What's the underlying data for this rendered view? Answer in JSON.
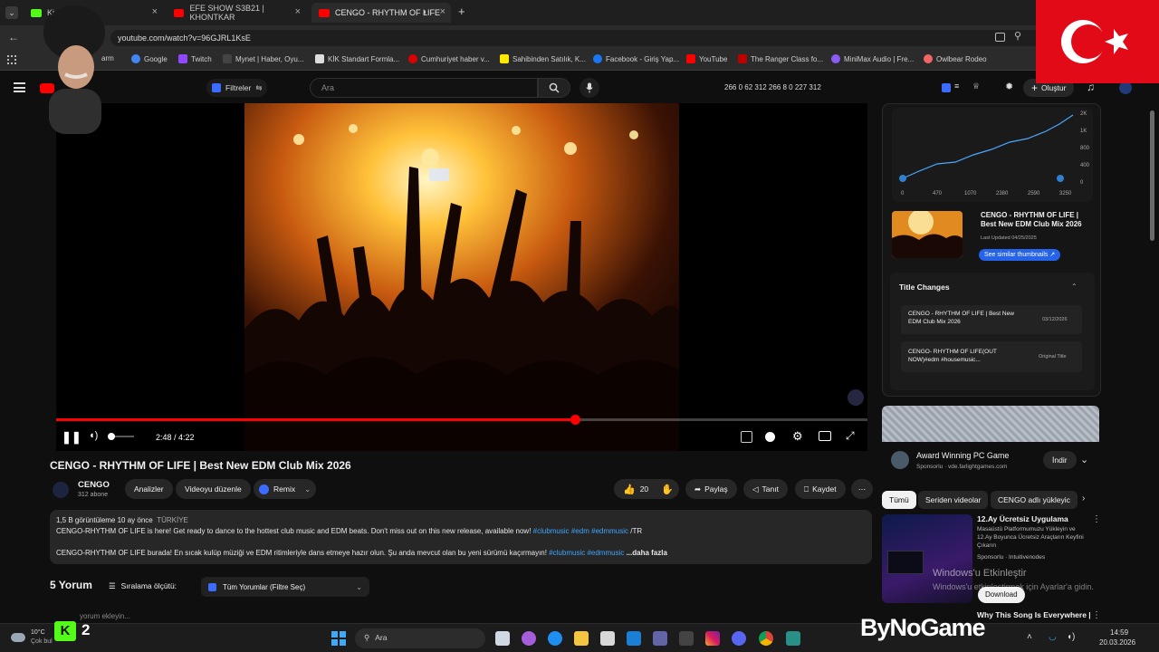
{
  "browser": {
    "tabs": [
      {
        "title": "Kick",
        "favicon_color": "#53fc18"
      },
      {
        "title": "EFE SHOW S3B21 | KHONTKAR",
        "favicon_color": "#ff0000"
      },
      {
        "title": "CENGO - RHYTHM OF LIFE",
        "favicon_color": "#ff0000",
        "active": true
      }
    ],
    "new_tab": "+",
    "url": "youtube.com/watch?v=96GJRL1KsE",
    "bookmarks": [
      {
        "label": "arm",
        "color": "#e44"
      },
      {
        "label": "Google",
        "color": "#4285f4"
      },
      {
        "label": "Twitch",
        "color": "#9146ff"
      },
      {
        "label": "Mynet | Haber, Oyu...",
        "color": "#333"
      },
      {
        "label": "KİK Standart Formla...",
        "color": "#ddd"
      },
      {
        "label": "Cumhuriyet haber v...",
        "color": "#d00"
      },
      {
        "label": "Sahibinden Satılık, K...",
        "color": "#ffe800"
      },
      {
        "label": "Facebook - Giriş Yap...",
        "color": "#1877f2"
      },
      {
        "label": "YouTube",
        "color": "#ff0000"
      },
      {
        "label": "The Ranger Class fo...",
        "color": "#b00"
      },
      {
        "label": "MiniMax Audio | Fre...",
        "color": "#8a5cf6"
      },
      {
        "label": "Owlbear Rodeo",
        "color": "#e66"
      }
    ]
  },
  "header": {
    "filters_label": "Filtreler",
    "search_placeholder": "Ara",
    "stats": "266  0  62  312  266  8  0  227  312",
    "create_label": "Oluştur"
  },
  "player": {
    "time": "2:48 / 4:22",
    "progress": 0.64,
    "volume": 0.1
  },
  "video": {
    "title": "CENGO - RHYTHM OF LIFE | Best New EDM Club Mix 2026",
    "channel": "CENGO",
    "subscribers": "312 abone",
    "btn_analytics": "Analizler",
    "btn_edit": "Videoyu düzenle",
    "btn_remix": "Remix",
    "likes": "20",
    "btn_share": "Paylaş",
    "btn_promote": "Tanıt",
    "btn_save": "Kaydet",
    "desc_meta": "1,5 B görüntüleme  10 ay önce",
    "desc_country": "TÜRKİYE",
    "desc_line1": "CENGO-RHYTHM OF LIFE is here! Get ready to dance to the hottest club music and EDM beats. Don't miss out on this new release, available now! ",
    "desc_tags1": "#clubmusic #edm #edmmusic",
    "desc_tail1": " /TR",
    "desc_line2": "CENGO-RHYTHM OF LIFE  burada! En sıcak kulüp müziği ve EDM ritimleriyle dans etmeye hazır olun. Şu anda mevcut olan bu yeni sürümü kaçırmayın! ",
    "desc_tags2": "#clubmusic #edmmusic",
    "desc_more": " ...daha fazla",
    "comments_count": "5 Yorum",
    "sort_label": "Sıralama ölçütü:",
    "comment_filter": "Tüm Yorumlar (Filtre Seç)",
    "add_comment": "yorum ekleyin..."
  },
  "side": {
    "chart_y_ticks": [
      "2K",
      "1K",
      "800",
      "400",
      "0"
    ],
    "chart_x_ticks": [
      "0",
      "470",
      "1070",
      "2380",
      "2590",
      "3250"
    ],
    "thumb_title": "CENGO - RHYTHM OF LIFE | Best New EDM Club Mix 2026",
    "last_updated": "Last Updated 04/25/2025",
    "similar_btn": "See similar thumbnails",
    "title_changes_header": "Title Changes",
    "change1_title": "CENGO - RHYTHM OF LIFE | Best New EDM Club Mix 2026",
    "change1_date": "03/12/2026",
    "change2_title": "CENGO- RHYTHM OF LIFE(OUT NOW)#edm #housemusic...",
    "change2_date": "Original Title"
  },
  "ad": {
    "title": "Award Winning PC Game",
    "sponsor": "Sponsorlu · vde.farlightgames.com",
    "install": "İndir"
  },
  "chips": [
    "Tümü",
    "Seriden videolar",
    "CENGO adlı yükleyic"
  ],
  "rec": {
    "title": "12.Ay Ücretsiz Uygulama",
    "desc": "Masaüstü Platformumuzu Yükleyin ve 12.Ay Boyunca Ücretsiz Araçların Keyfini Çıkarın",
    "sponsor": "Sponsorlu · Intuitivenodes",
    "download": "Download",
    "title2": "Why This Song Is Everywhere |"
  },
  "watermark": {
    "activate_line1": "Windows'u Etkinleştir",
    "activate_line2": "Windows'u etkinleştirmek için Ayarlar'a gidin."
  },
  "taskbar": {
    "weather_temp": "10°C",
    "weather_desc": "Çok bul",
    "search": "Ara",
    "time": "14:59",
    "date": "20.03.2026",
    "kick_count": "2",
    "brand": "ByNoGame"
  }
}
